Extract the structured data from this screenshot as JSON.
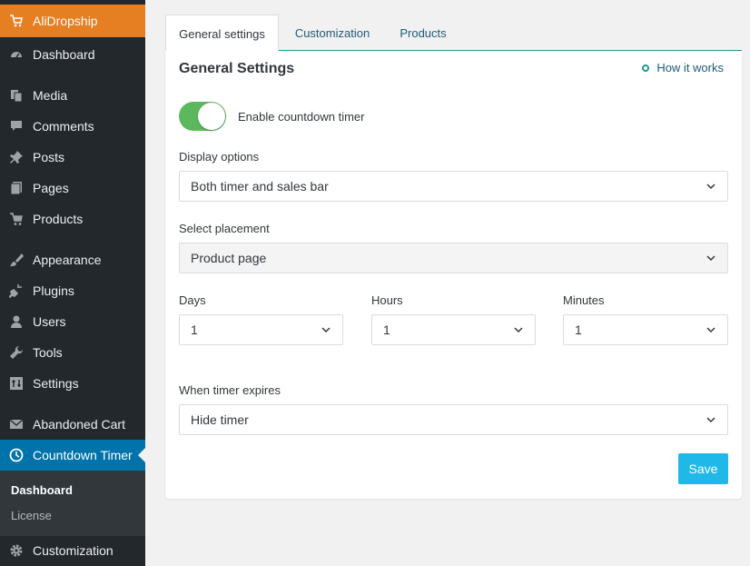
{
  "sidebar": {
    "brand": {
      "label": "AliDropship",
      "icon": "cart-flag-icon"
    },
    "items": [
      {
        "label": "Dashboard",
        "icon": "dashboard-icon"
      },
      {
        "label": "Media",
        "icon": "media-icon"
      },
      {
        "label": "Comments",
        "icon": "comments-icon"
      },
      {
        "label": "Posts",
        "icon": "pin-icon"
      },
      {
        "label": "Pages",
        "icon": "pages-icon"
      },
      {
        "label": "Products",
        "icon": "cart-icon"
      },
      {
        "label": "Appearance",
        "icon": "brush-icon"
      },
      {
        "label": "Plugins",
        "icon": "plugin-icon"
      },
      {
        "label": "Users",
        "icon": "user-icon"
      },
      {
        "label": "Tools",
        "icon": "wrench-icon"
      },
      {
        "label": "Settings",
        "icon": "settings-icon"
      },
      {
        "label": "Abandoned Cart",
        "icon": "envelope-icon"
      },
      {
        "label": "Countdown Timer",
        "icon": "clock-icon"
      },
      {
        "label": "Customization",
        "icon": "gear-icon"
      }
    ],
    "submenu": [
      {
        "label": "Dashboard"
      },
      {
        "label": "License"
      }
    ]
  },
  "tabs": [
    {
      "label": "General settings"
    },
    {
      "label": "Customization"
    },
    {
      "label": "Products"
    }
  ],
  "panel": {
    "title": "General Settings",
    "how_link": "How it works",
    "toggle_label": "Enable countdown timer",
    "display_options": {
      "label": "Display options",
      "value": "Both timer and sales bar"
    },
    "placement": {
      "label": "Select placement",
      "value": "Product page"
    },
    "days": {
      "label": "Days",
      "value": "1"
    },
    "hours": {
      "label": "Hours",
      "value": "1"
    },
    "minutes": {
      "label": "Minutes",
      "value": "1"
    },
    "expires": {
      "label": "When timer expires",
      "value": "Hide timer"
    },
    "save_label": "Save"
  },
  "colors": {
    "accent": "#1fb8e8",
    "toggle_on": "#5cb85c",
    "brand": "#e67e22",
    "active_menu": "#0073aa"
  }
}
